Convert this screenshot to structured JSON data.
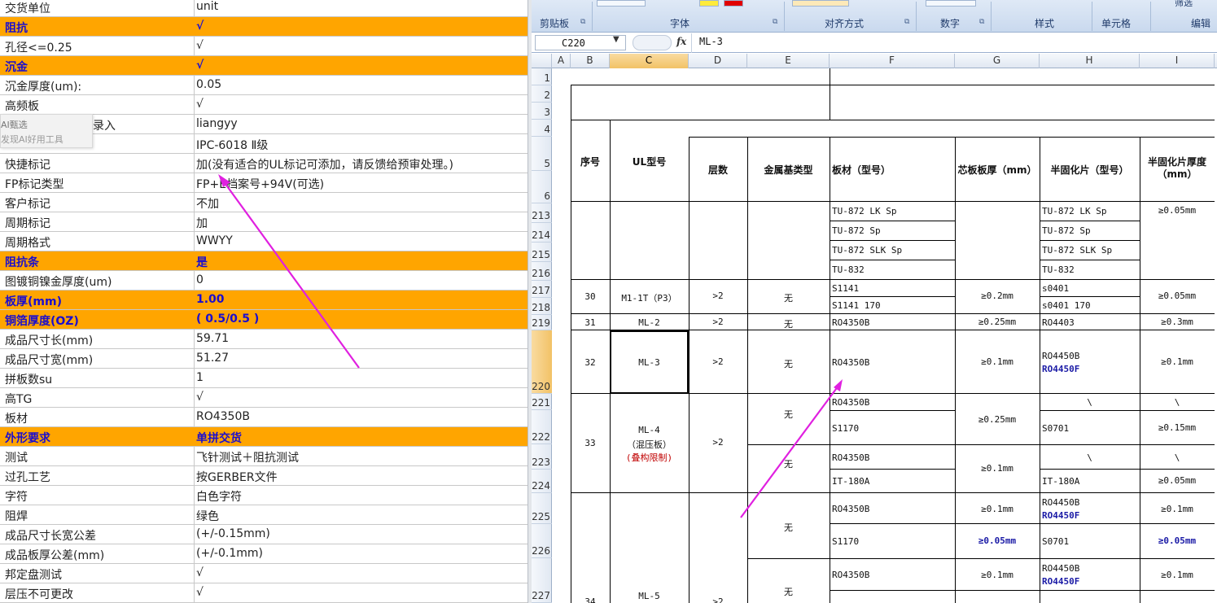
{
  "left_panel": {
    "rows": [
      {
        "key": "交货单位",
        "value": "unit",
        "highlight": false
      },
      {
        "key": "阻抗",
        "value": "√",
        "highlight": true
      },
      {
        "key": "孔径<=0.25",
        "value": "√",
        "highlight": false
      },
      {
        "key": "沉金",
        "value": "√",
        "highlight": true
      },
      {
        "key": "沉金厚度(um):",
        "value": "0.05",
        "highlight": false
      },
      {
        "key": "高频板",
        "value": "√",
        "highlight": false
      },
      {
        "key": "录入",
        "value": "liangyy",
        "highlight": false
      },
      {
        "key": "",
        "value": "IPC-6018 Ⅱ级",
        "highlight": false
      },
      {
        "key": "快捷标记",
        "value": "加(没有适合的UL标记可添加，请反馈给预审处理。)",
        "highlight": false
      },
      {
        "key": "FP标记类型",
        "value": "FP+E档案号+94V(可选)",
        "highlight": false
      },
      {
        "key": "客户标记",
        "value": "不加",
        "highlight": false
      },
      {
        "key": "周期标记",
        "value": "加",
        "highlight": false
      },
      {
        "key": "周期格式",
        "value": "WWYY",
        "highlight": false
      },
      {
        "key": "阻抗条",
        "value": "是",
        "highlight": true
      },
      {
        "key": "图镀铜镍金厚度(um)",
        "value": "0",
        "highlight": false
      },
      {
        "key": "板厚(mm)",
        "value": "1.00",
        "highlight": true
      },
      {
        "key": "铜箔厚度(OZ)",
        "value": "( 0.5/0.5 )",
        "highlight": true
      },
      {
        "key": "成品尺寸长(mm)",
        "value": "59.71",
        "highlight": false
      },
      {
        "key": "成品尺寸宽(mm)",
        "value": "51.27",
        "highlight": false
      },
      {
        "key": "拼板数su",
        "value": "1",
        "highlight": false
      },
      {
        "key": "高TG",
        "value": "√",
        "highlight": false
      },
      {
        "key": "板材",
        "value": "RO4350B",
        "highlight": false
      },
      {
        "key": "外形要求",
        "value": "单拼交货",
        "highlight": true
      },
      {
        "key": "测试",
        "value": "飞针测试＋阻抗测试",
        "highlight": false
      },
      {
        "key": "过孔工艺",
        "value": "按GERBER文件",
        "highlight": false
      },
      {
        "key": "字符",
        "value": "白色字符",
        "highlight": false
      },
      {
        "key": "阻焊",
        "value": "绿色",
        "highlight": false
      },
      {
        "key": "成品尺寸长宽公差",
        "value": "(+/-0.15mm)",
        "highlight": false
      },
      {
        "key": "成品板厚公差(mm)",
        "value": "(+/-0.1mm)",
        "highlight": false
      },
      {
        "key": "邦定盘测试",
        "value": "√",
        "highlight": false
      },
      {
        "key": "层压不可更改",
        "value": "√",
        "highlight": false
      }
    ],
    "ai_popup": {
      "line1": "AI甄选",
      "line2": "发现AI好用工具"
    },
    "highlight_color": "#ffa500"
  },
  "excel": {
    "ribbon_groups": [
      "剪贴板",
      "字体",
      "对齐方式",
      "数字",
      "样式",
      "单元格",
      "编辑"
    ],
    "ribbon_partial": "筛选",
    "name_box": "C220",
    "fx_label": "fx",
    "formula_value": "ML-3",
    "columns": [
      "A",
      "B",
      "C",
      "D",
      "E",
      "F",
      "G",
      "H",
      "I"
    ],
    "selected_column": "C",
    "row_numbers": [
      "1",
      "2",
      "3",
      "4",
      "5",
      "6",
      "213",
      "214",
      "215",
      "216",
      "217",
      "218",
      "219",
      "220",
      "221",
      "222",
      "223",
      "224",
      "225",
      "226",
      "227"
    ],
    "selected_row": "220",
    "headers": {
      "seq": "序号",
      "ul": "UL型号",
      "layers": "层数",
      "metal": "金属基类型",
      "board": "板材（型号）",
      "core": "芯板板厚（mm）",
      "prepreg": "半固化片（型号）",
      "prepreg_thick": "半固化片厚度（mm）"
    },
    "cells": {
      "f213": "TU-872 LK Sp",
      "f214": "TU-872 Sp",
      "f215": "TU-872 SLK Sp",
      "f216": "TU-832",
      "h213": "TU-872 LK Sp",
      "h214": "TU-872 Sp",
      "h215": "TU-872 SLK Sp",
      "h216": "TU-832",
      "i213": "≥0.05mm",
      "b217": "30",
      "c217": "M1-1T（P3）",
      "d217": ">2",
      "e217": "无",
      "f217": "S1141",
      "f218": "S1141 170",
      "g217": "≥0.2mm",
      "h217": "s0401",
      "h218": "s0401 170",
      "i217": "≥0.05mm",
      "b219": "31",
      "c219": "ML-2",
      "d219": ">2",
      "e219": "无",
      "f219": "RO4350B",
      "g219": "≥0.25mm",
      "h219": "RO4403",
      "i219": "≥0.3mm",
      "b220": "32",
      "c220": "ML-3",
      "d220": ">2",
      "e220": "无",
      "f220": "RO4350B",
      "g220": "≥0.1mm",
      "h220a": "RO4450B",
      "h220b": "RO4450F",
      "i220": "≥0.1mm",
      "b221": "33",
      "c221a": "ML-4",
      "c221b": "（混压板）",
      "c221c": "(叠构限制)",
      "d221": ">2",
      "e221": "无",
      "f221": "RO4350B",
      "f222": "S1170",
      "g221": "≥0.25mm",
      "h221": "\\",
      "h222": "S0701",
      "i221": "\\",
      "i222": "≥0.15mm",
      "e223": "无",
      "f223": "RO4350B",
      "f224": "IT-180A",
      "g223": "≥0.1mm",
      "h223": "\\",
      "h224": "IT-180A",
      "i223": "\\",
      "i224": "≥0.05mm",
      "e225": "无",
      "f225": "RO4350B",
      "f226": "S1170",
      "g225": "≥0.1mm",
      "g226": "≥0.05mm",
      "h225a": "RO4450B",
      "h225b": "RO4450F",
      "h226": "S0701",
      "i225": "≥0.1mm",
      "i226": "≥0.05mm",
      "b227": "34",
      "c227": "ML-5",
      "d227": ">2",
      "e227": "无",
      "f227": "RO4350B",
      "g227": "≥0.1mm",
      "h227a": "RO4450B",
      "h227b": "RO4450F",
      "i227": "≥0.1mm"
    }
  },
  "annotation_color": "#e020e0"
}
